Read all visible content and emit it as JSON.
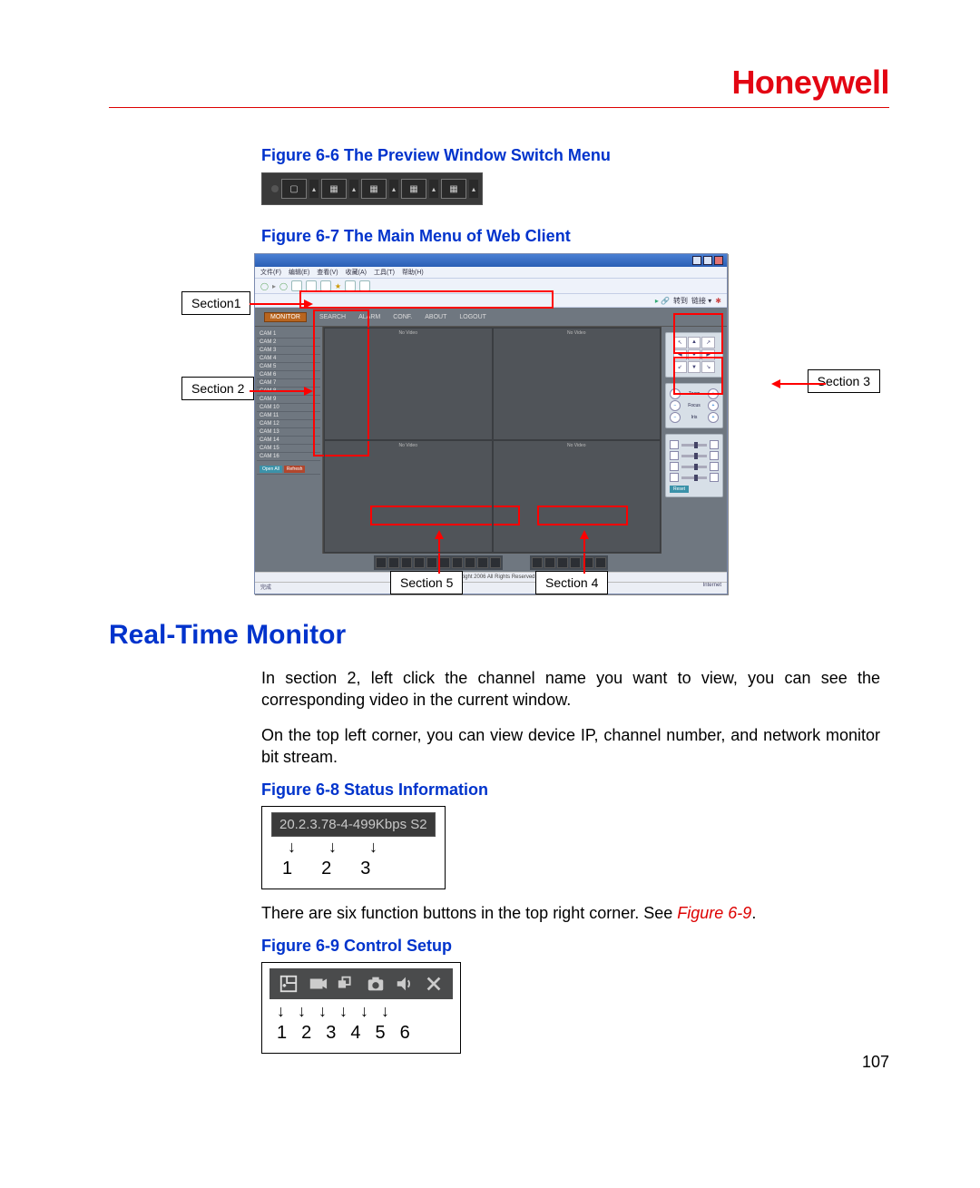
{
  "brand": "Honeywell",
  "page_number": "107",
  "figures": {
    "f66": {
      "caption": "Figure 6-6 The Preview Window Switch Menu"
    },
    "f67": {
      "caption": "Figure 6-7 The Main Menu of Web Client",
      "labels": {
        "section1": "Section1",
        "section2": "Section 2",
        "section3": "Section 3",
        "section4": "Section 4",
        "section5": "Section 5"
      },
      "browser": {
        "menus": [
          "文件(F)",
          "编辑(E)",
          "查看(V)",
          "收藏(A)",
          "工具(T)",
          "帮助(H)"
        ],
        "tabs": {
          "monitor": "MONITOR",
          "search": "SEARCH",
          "alarm": "ALARM",
          "conf": "CONF.",
          "about": "ABOUT",
          "logout": "LOGOUT"
        },
        "channels": [
          "CAM 1",
          "CAM 2",
          "CAM 3",
          "CAM 4",
          "CAM 5",
          "CAM 6",
          "CAM 7",
          "CAM 8",
          "CAM 9",
          "CAM 10",
          "CAM 11",
          "CAM 12",
          "CAM 13",
          "CAM 14",
          "CAM 15",
          "CAM 16"
        ],
        "open_btn": "Open All",
        "refresh_btn": "Refresh",
        "zoom_label": "Zoom",
        "focus_label": "Focus",
        "iris_label": "Iris",
        "reset": "Reset",
        "copyright": "CopyRight 2006 All Rights Reserved"
      }
    },
    "f68": {
      "caption": "Figure 6-8 Status Information",
      "status_text": "20.2.3.78-4-499Kbps S2",
      "items": [
        "1",
        "2",
        "3"
      ]
    },
    "f69": {
      "caption": "Figure 6-9 Control Setup",
      "items": [
        "1",
        "2",
        "3",
        "4",
        "5",
        "6"
      ],
      "icons": [
        "digital-zoom-icon",
        "local-record-icon",
        "multi-screen-icon",
        "snapshot-icon",
        "audio-icon",
        "close-icon"
      ]
    }
  },
  "section_heading": "Real-Time Monitor",
  "paragraphs": {
    "p1": "In section 2, left click the channel name you want to view, you can see the corresponding video in the current window.",
    "p2": "On the top left corner, you can view device IP, channel number, and network monitor bit stream.",
    "p3a": "There are six function buttons in the top right corner. See ",
    "p3b": "Figure 6-9",
    "p3c": "."
  }
}
